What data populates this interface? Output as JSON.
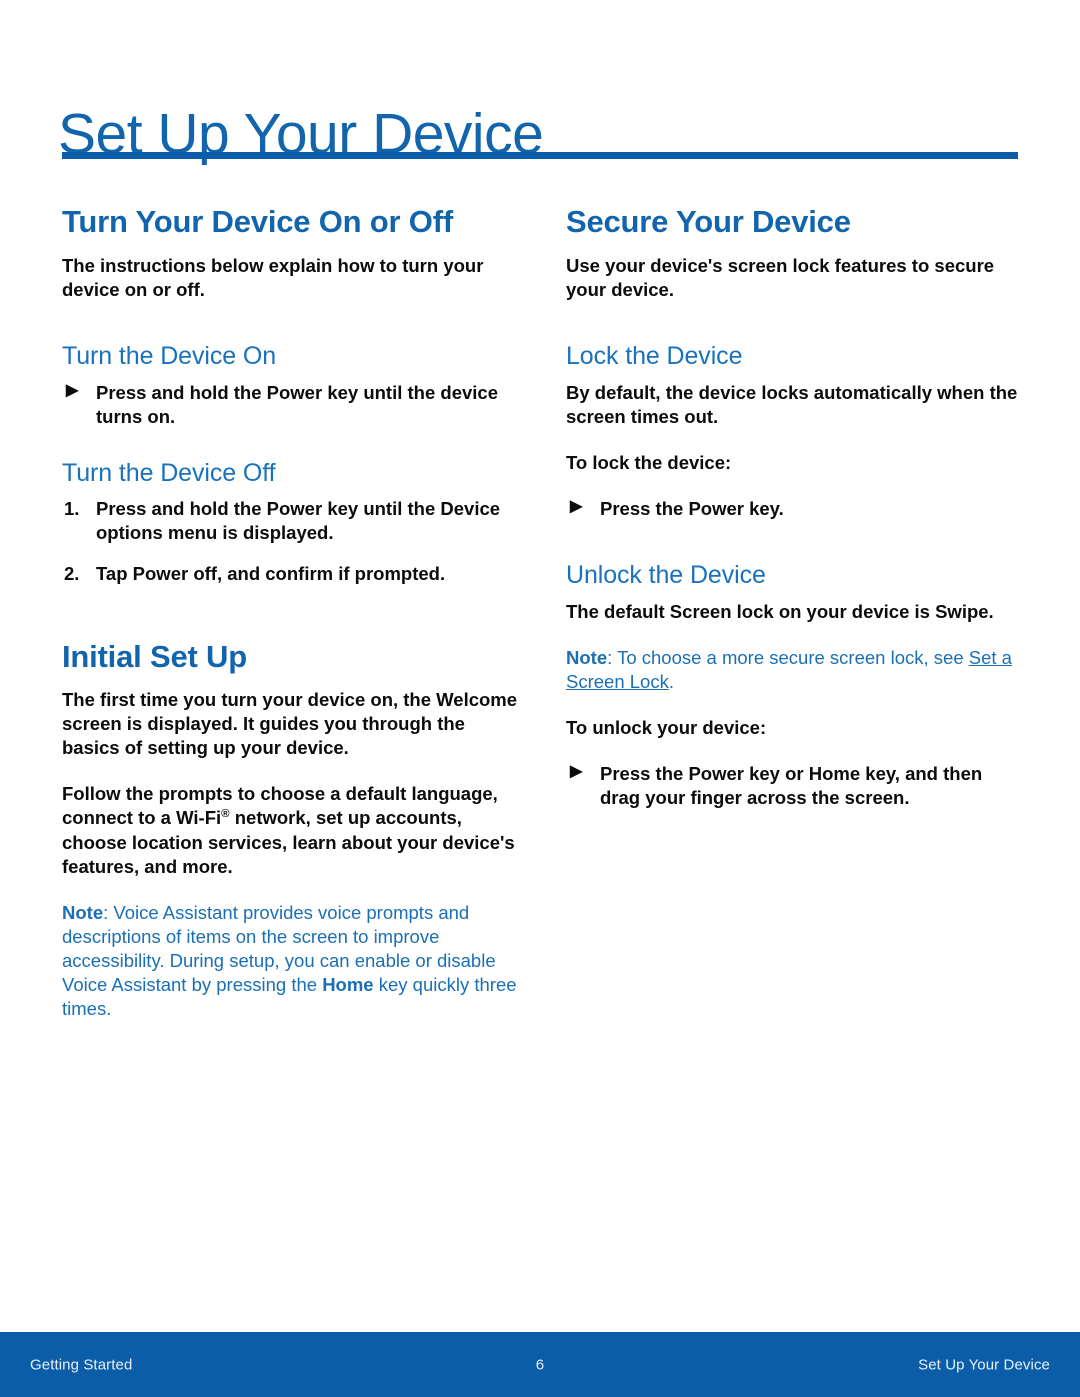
{
  "page": {
    "title": "Set Up Your Device",
    "accent_blue": "#0a5da6",
    "heading_blue": "#1265ad",
    "subheading_blue": "#1a72bd",
    "note_blue": "#1b6fb5"
  },
  "left_column": {
    "section1": {
      "heading": "Turn Your Device On or Off",
      "intro": "The instructions below explain how to turn your device on or off.",
      "sub1": {
        "heading": "Turn the Device On",
        "bullet_marker": "triangle-right-icon",
        "item_prefix": "Press and hold the ",
        "item_key": "Power",
        "item_suffix": " key until the device turns on."
      },
      "sub2": {
        "heading": "Turn the Device Off",
        "steps": [
          {
            "number": "1.",
            "prefix": "Press and hold the ",
            "key": "Power",
            "suffix": " key until the Device options menu is displayed."
          },
          {
            "number": "2.",
            "prefix": "Tap ",
            "key": "Power off",
            "suffix": ", and confirm if prompted."
          }
        ]
      }
    },
    "section2": {
      "heading": "Initial Set Up",
      "para1": "The first time you turn your device on, the Welcome screen is displayed. It guides you through the basics of setting up your device.",
      "para2_part1": "Follow the prompts to choose a default language, connect to a Wi-Fi",
      "para2_trademark": "®",
      "para2_part2": " network, set up accounts, choose location services, learn about your device's features, and more.",
      "note": {
        "label": "Note",
        "text_part1": ": Voice Assistant provides voice prompts and descriptions of items on the screen to improve accessibility. During setup, you can enable or disable Voice Assistant by pressing the ",
        "key": "Home",
        "text_part2": " key quickly three times."
      }
    }
  },
  "right_column": {
    "section1": {
      "heading": "Secure Your Device",
      "intro": "Use your device's screen lock features to secure your device.",
      "sub1": {
        "heading": "Lock the Device",
        "para": "By default, the device locks automatically when the screen times out.",
        "lead_in": "To lock the device:",
        "bullet_marker": "triangle-right-icon",
        "item_prefix": "Press the ",
        "item_key": "Power",
        "item_suffix": " key."
      },
      "sub2": {
        "heading": "Unlock the Device",
        "para": "The default Screen lock on your device is Swipe.",
        "note": {
          "label": "Note",
          "text_part1": ": To choose a more secure screen lock, see ",
          "link": "Set a Screen Lock",
          "text_part2": "."
        },
        "lead_in": "To unlock your device:",
        "bullet_marker": "triangle-right-icon",
        "item_prefix": "Press the ",
        "item_key1": "Power",
        "item_mid": " key or ",
        "item_key2": "Home",
        "item_suffix": " key, and then drag your finger across the screen."
      }
    }
  },
  "footer": {
    "left": "Getting Started",
    "page_number": "6",
    "right": "Set Up Your Device"
  }
}
